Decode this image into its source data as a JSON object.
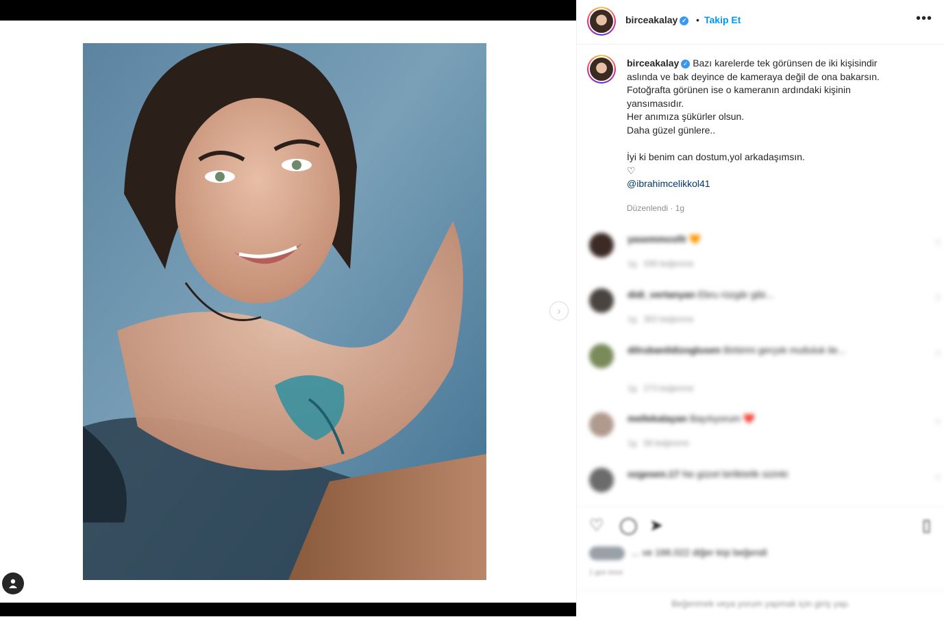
{
  "post": {
    "username": "birceakalay",
    "follow_label": "Takip Et",
    "dot": "•",
    "more_icon": "more-horizontal-icon",
    "caption_lines": [
      "Bazı karelerde tek görünsen de iki kişisindir",
      "aslında ve bak deyince de kameraya değil de ona bakarsın.",
      "Fotoğrafta görünen ise o kameranın ardındaki kişinin",
      "yansımasıdır.",
      "Her anımıza şükürler olsun.",
      "Daha güzel günlere..",
      "İyi ki benim can dostum,yol arkadaşımsın.",
      "♡"
    ],
    "mention": "@ibrahimcelikkol41",
    "edited": "Düzenlendi · 1g"
  },
  "comments": [
    {
      "user": "yasemmosfit",
      "text": "🧡",
      "time": "1g",
      "likes": "438 beğenme"
    },
    {
      "user": "didi_vertanyan",
      "text": "Ebru rüzgâr gibi...",
      "time": "1g",
      "likes": "363 beğenme"
    },
    {
      "user": "dilrubanildizoglusen",
      "text": "Birbirini gerçek mutluluk ile...",
      "time": "1g",
      "likes": "273 beğenme"
    },
    {
      "user": "mellekalayan",
      "text": "Bayılıyorum ❤️",
      "time": "1g",
      "likes": "58 beğenme"
    },
    {
      "user": "ozgesen.17",
      "text": "Ne güzel birliktelik sizinki",
      "time": "",
      "likes": ""
    }
  ],
  "likes_text": "... ve 166.022 diğer kişi beğendi",
  "likes_date": "1 gün önce",
  "login_text": "Beğenmek veya yorum yapmak için giriş yap.",
  "nav": {
    "next_icon": "chevron-right-icon",
    "user_tag_icon": "user-icon"
  },
  "colors": {
    "accent": "#0095f6",
    "verified": "#3897f0",
    "text": "#262626",
    "muted": "#8e8e8e"
  }
}
